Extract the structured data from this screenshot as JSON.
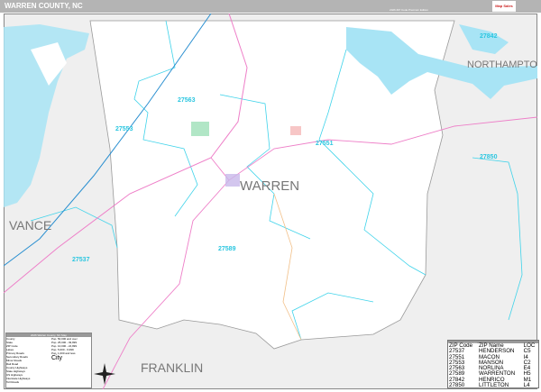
{
  "header": {
    "title": "WARREN COUNTY, NC",
    "edition": "2026 ZIP Code Premium Edition",
    "logo": "Map Sales"
  },
  "map": {
    "county_label": "WARREN",
    "neighbors": [
      {
        "name": "VANCE"
      },
      {
        "name": "FRANKLIN"
      },
      {
        "name": "NORTHAMPTON"
      }
    ],
    "zip_labels": [
      "27563",
      "27553",
      "27551",
      "27850",
      "27589",
      "27537",
      "27842"
    ],
    "colors": {
      "water": "#a8e4f5",
      "zip_boundary": "#3fd3ea",
      "highway": "#ee7fc8",
      "interstate": "#2a8fd0",
      "outside": "#efefef"
    }
  },
  "legend": {
    "title": "2026 Warren County, NC Map",
    "items": [
      "County",
      "State",
      "ZIP Code",
      "Lakes",
      "Primary Roads",
      "Secondary Roads",
      "Minor Roads",
      "Rail Road",
      "County Highways",
      "State Highways",
      "US Highways",
      "Interstate Highways",
      "Toll Roads"
    ],
    "city_sizes": [
      "Pop. 50,000 and over",
      "Pop. 25,000 - 49,999",
      "Pop. 10,000 - 24,999",
      "Pop. 5,000 - 9,999",
      "Pop. 1,000 and less"
    ],
    "city_label": "City"
  },
  "zip_index": {
    "title": "ZIP Code Index/Grid Locator",
    "headers": [
      "ZIP Code",
      "ZIP Name",
      "LOC"
    ],
    "rows": [
      [
        "27537",
        "HENDERSON",
        "C5"
      ],
      [
        "27551",
        "MACON",
        "I4"
      ],
      [
        "27553",
        "MANSON",
        "C2"
      ],
      [
        "27563",
        "NORLINA",
        "E4"
      ],
      [
        "27589",
        "WARRENTON",
        "H5"
      ],
      [
        "27842",
        "HENRICO",
        "M1"
      ],
      [
        "27850",
        "LITTLETON",
        "L4"
      ]
    ]
  }
}
